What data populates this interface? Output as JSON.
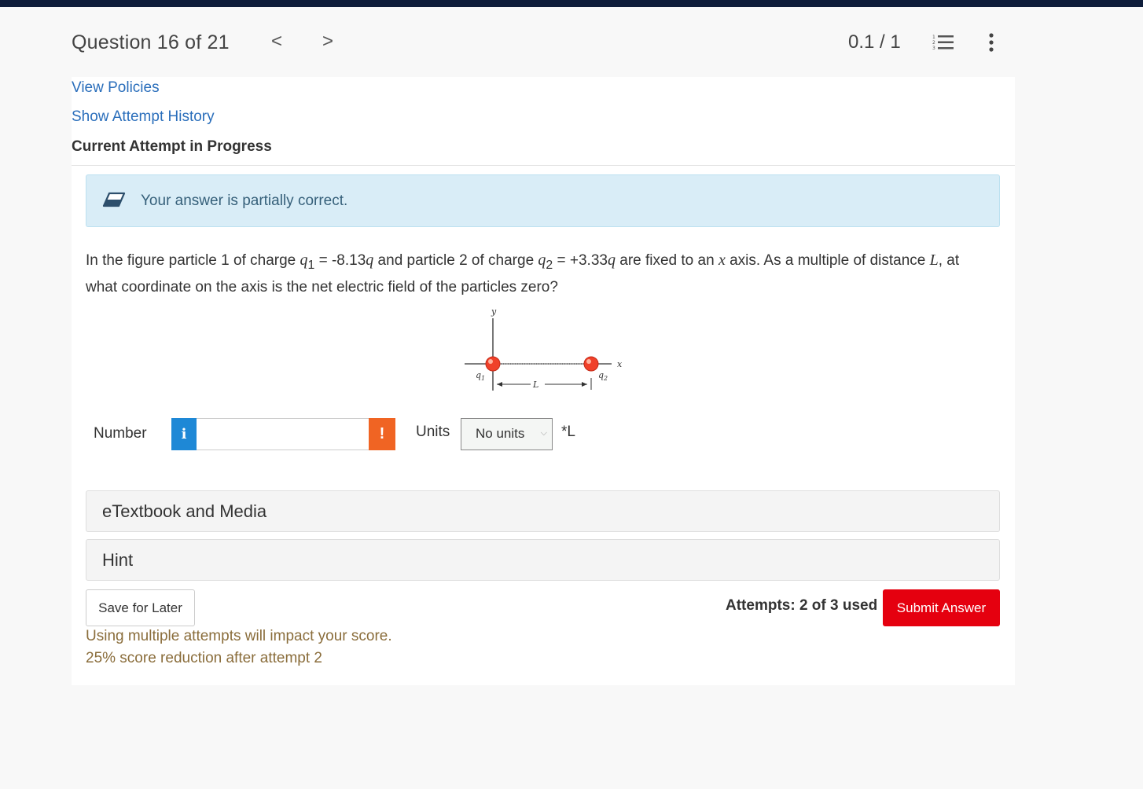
{
  "header": {
    "question_label": "Question 16 of 21",
    "prev_arrow": "<",
    "next_arrow": ">",
    "score": "0.1 / 1",
    "list_icon": "numbered-list-icon",
    "more_icon": "vertical-ellipsis-icon"
  },
  "links": {
    "view_policies": "View Policies",
    "show_attempt_history": "Show Attempt History"
  },
  "attempt_title": "Current Attempt in Progress",
  "feedback": {
    "icon": "eraser-icon",
    "text": "Your answer is partially correct.",
    "color": "#d9edf7"
  },
  "question": {
    "p1": "In the figure particle 1 of charge ",
    "q1": "q",
    "q1_sub": "1",
    "p2": " = -8.13",
    "q": "q",
    "p3": " and particle 2 of charge ",
    "q2": "q",
    "q2_sub": "2",
    "p4": " = +3.33",
    "p5": " are fixed to an ",
    "x": "x",
    "p6": " axis. As a multiple of distance ",
    "L": "L",
    "p7": ", at what coordinate on the axis is the net electric field of the particles zero?"
  },
  "figure": {
    "y_label": "y",
    "x_label": "x",
    "q1_label": "q",
    "q1_sub": "1",
    "q2_label": "q",
    "q2_sub": "2",
    "L_label": "L",
    "particle_color": "#f0412a"
  },
  "answer": {
    "number_label": "Number",
    "info_label": "i",
    "value": "",
    "warn_label": "!",
    "units_label": "Units",
    "units_selected": "No units",
    "multiplier": "*L"
  },
  "sections": {
    "etextbook": "eTextbook and Media",
    "hint": "Hint"
  },
  "actions": {
    "save_label": "Save for Later",
    "attempts": "Attempts: 2 of 3 used",
    "submit_label": "Submit Answer",
    "submit_color": "#e5000f"
  },
  "notes": {
    "line1": "Using multiple attempts will impact your score.",
    "line2": "25% score reduction after attempt 2"
  }
}
